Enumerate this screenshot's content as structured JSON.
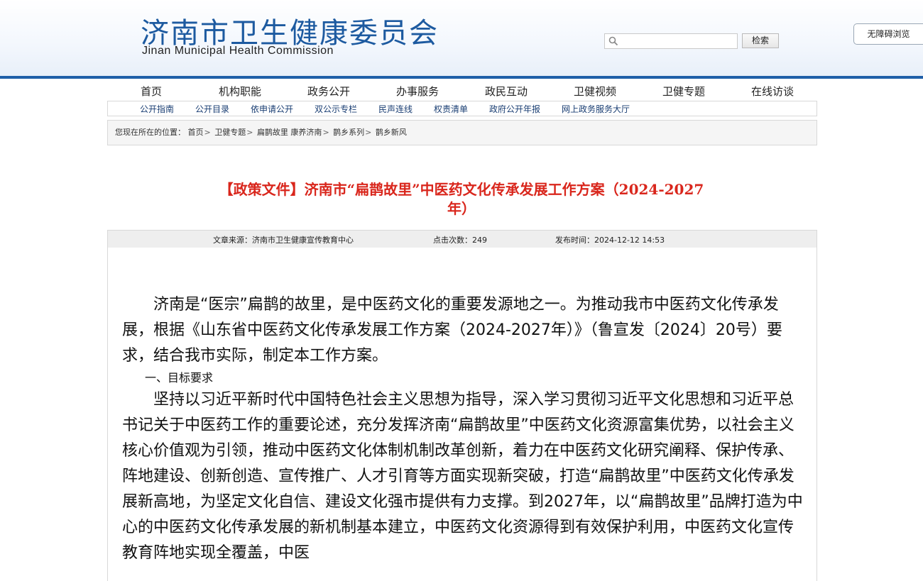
{
  "header": {
    "logo_cn": "济南市卫生健康委员会",
    "logo_en": "Jinan Municipal Health Commission",
    "search_placeholder": "",
    "search_button": "检索",
    "accessibility_button": "无障碍浏览",
    "accent_color": "#1f5fa8"
  },
  "main_nav": [
    "首页",
    "机构职能",
    "政务公开",
    "办事服务",
    "政民互动",
    "卫健视频",
    "卫健专题",
    "在线访谈"
  ],
  "sub_nav": [
    "公开指南",
    "公开目录",
    "依申请公开",
    "双公示专栏",
    "民声连线",
    "权责清单",
    "政府公开年报",
    "网上政务服务大厅"
  ],
  "breadcrumb": {
    "prefix": "您现在所在的位置：",
    "items": [
      "首页",
      "卫健专题",
      "扁鹊故里 康养济南",
      "鹊乡系列",
      "鹊乡新风"
    ],
    "separator": ">"
  },
  "article": {
    "title_line1": "【政策文件】济南市“扁鹊故里”中医药文化传承发展工作方案（2024-2027",
    "title_line2": "年）",
    "title_color": "#d9261c",
    "source": "文章来源：济南市卫生健康宣传教育中心",
    "clicks": "点击次数：249",
    "published": "发布时间：2024-12-12 14:53",
    "paragraphs": [
      "济南是“医宗”扁鹊的故里，是中医药文化的重要发源地之一。为推动我市中医药文化传承发展，根据《山东省中医药文化传承发展工作方案（2024-2027年）》（鲁宣发〔2024〕20号）要求，结合我市实际，制定本工作方案。",
      "一、目标要求",
      "坚持以习近平新时代中国特色社会主义思想为指导，深入学习贯彻习近平文化思想和习近平总书记关于中医药工作的重要论述，充分发挥济南“扁鹊故里”中医药文化资源富集优势，以社会主义核心价值观为引领，推动中医药文化体制机制改革创新，着力在中医药文化研究阐释、保护传承、阵地建设、创新创造、宣传推广、人才引育等方面实现新突破，打造“扁鹊故里”中医药文化传承发展新高地，为坚定文化自信、建设文化强市提供有力支撑。到2027年，以“扁鹊故里”品牌打造为中心的中医药文化传承发展的新机制基本建立，中医药文化资源得到有效保护利用，中医药文化宣传教育阵地实现全覆盖，中医"
    ]
  }
}
